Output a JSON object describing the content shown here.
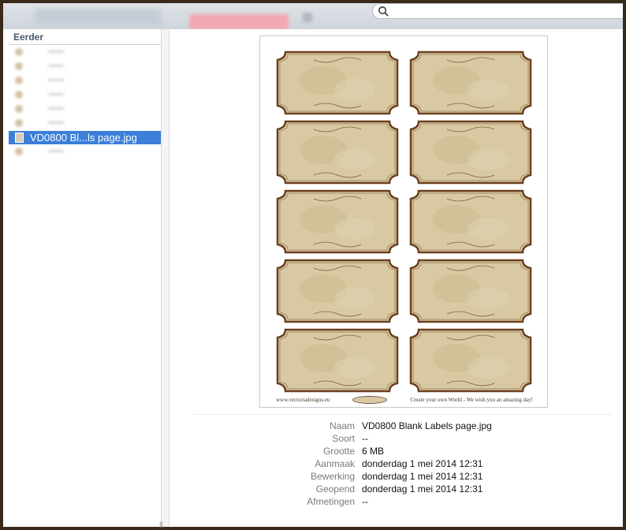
{
  "search": {
    "placeholder": ""
  },
  "sidebar": {
    "header": "Eerder",
    "selected_item": "VD0800 Bl...ls page.jpg"
  },
  "preview": {
    "footer_left": "www.vectoriadesigns.eu",
    "footer_right": "Create your own World - We wish you an amazing day!",
    "label_count": 10
  },
  "info": {
    "rows": [
      {
        "key": "Naam",
        "value": "VD0800 Blank Labels page.jpg"
      },
      {
        "key": "Soort",
        "value": "--"
      },
      {
        "key": "Grootte",
        "value": "6 MB"
      },
      {
        "key": "Aanmaak",
        "value": "donderdag 1 mei 2014 12:31"
      },
      {
        "key": "Bewerking",
        "value": "donderdag 1 mei 2014 12:31"
      },
      {
        "key": "Geopend",
        "value": "donderdag 1 mei 2014 12:31"
      },
      {
        "key": "Afmetingen",
        "value": "--"
      }
    ]
  },
  "colors": {
    "selection": "#3b7fd8",
    "label_parchment": "#d8c9a2",
    "label_border": "#6b3f1e"
  }
}
